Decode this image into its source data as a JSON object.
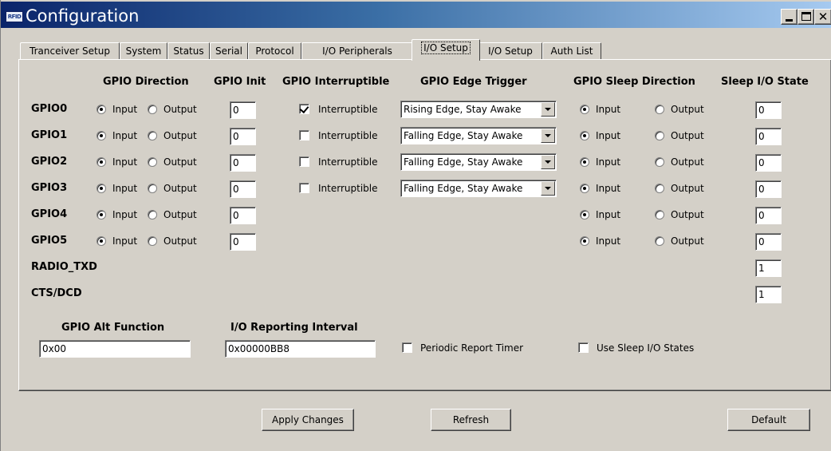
{
  "window": {
    "title": "Configuration",
    "app_icon_text": "RFID"
  },
  "tabs": [
    {
      "label": "Tranceiver Setup",
      "active": false
    },
    {
      "label": "System",
      "active": false
    },
    {
      "label": "Status",
      "active": false
    },
    {
      "label": "Serial",
      "active": false
    },
    {
      "label": "Protocol",
      "active": false
    },
    {
      "label": "I/O Peripherals",
      "active": false
    },
    {
      "label": "I/O Setup",
      "active": true
    },
    {
      "label": "I/O Setup",
      "active": false
    },
    {
      "label": "Auth List",
      "active": false
    }
  ],
  "headers": {
    "direction": "GPIO Direction",
    "init": "GPIO Init",
    "interruptible": "GPIO Interruptible",
    "edge": "GPIO Edge Trigger",
    "sleep_direction": "GPIO Sleep Direction",
    "sleep_state": "Sleep I/O State"
  },
  "labels": {
    "input": "Input",
    "output": "Output",
    "interruptible": "Interruptible"
  },
  "gpio": [
    {
      "name": "GPIO0",
      "direction": "Input",
      "init": "0",
      "interruptible": true,
      "edge": "Rising Edge, Stay Awake",
      "sleep_direction": "Input",
      "sleep_state": "0"
    },
    {
      "name": "GPIO1",
      "direction": "Input",
      "init": "0",
      "interruptible": false,
      "edge": "Falling Edge, Stay Awake",
      "sleep_direction": "Input",
      "sleep_state": "0"
    },
    {
      "name": "GPIO2",
      "direction": "Input",
      "init": "0",
      "interruptible": false,
      "edge": "Falling Edge, Stay Awake",
      "sleep_direction": "Input",
      "sleep_state": "0"
    },
    {
      "name": "GPIO3",
      "direction": "Input",
      "init": "0",
      "interruptible": false,
      "edge": "Falling Edge, Stay Awake",
      "sleep_direction": "Input",
      "sleep_state": "0"
    },
    {
      "name": "GPIO4",
      "direction": "Input",
      "init": "0",
      "sleep_direction": "Input",
      "sleep_state": "0"
    },
    {
      "name": "GPIO5",
      "direction": "Input",
      "init": "0",
      "sleep_direction": "Input",
      "sleep_state": "0"
    }
  ],
  "extra_pins": [
    {
      "name": "RADIO_TXD",
      "sleep_state": "1"
    },
    {
      "name": "CTS/DCD",
      "sleep_state": "1"
    }
  ],
  "alt_function": {
    "label": "GPIO Alt Function",
    "value": "0x00"
  },
  "reporting_interval": {
    "label": "I/O Reporting Interval",
    "value": "0x00000BB8"
  },
  "periodic_report_timer": {
    "label": "Periodic Report Timer",
    "checked": false
  },
  "use_sleep_io_states": {
    "label": "Use Sleep I/O States",
    "checked": false
  },
  "buttons": {
    "apply": "Apply Changes",
    "refresh": "Refresh",
    "default": "Default"
  }
}
